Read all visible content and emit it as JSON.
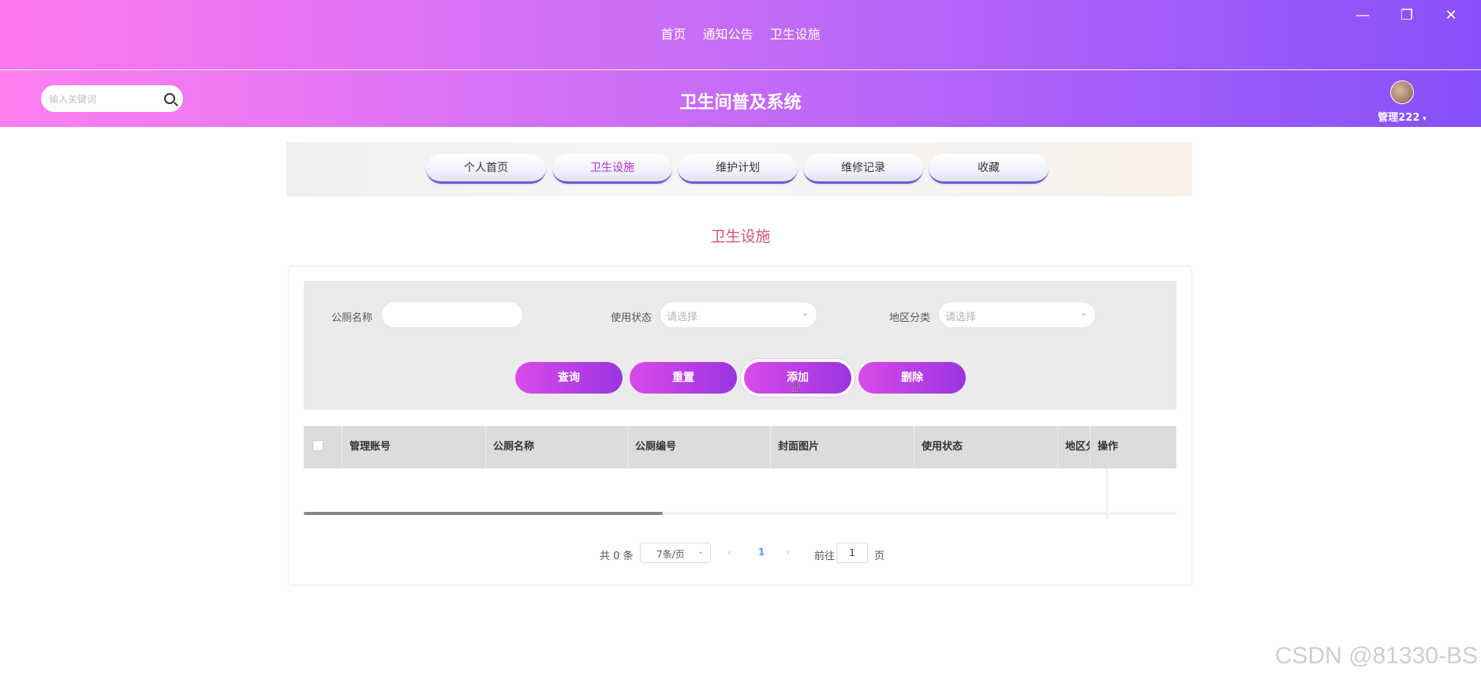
{
  "topnav": {
    "items": [
      "首页",
      "通知公告",
      "卫生设施"
    ]
  },
  "window_controls": {
    "minimize": "—",
    "restore": "❐",
    "close": "✕"
  },
  "header": {
    "search_placeholder": "输入关键词",
    "title": "卫生间普及系统",
    "user_name": "管理222",
    "caret": "▾"
  },
  "tabs": [
    {
      "label": "个人首页",
      "active": false
    },
    {
      "label": "卫生设施",
      "active": true
    },
    {
      "label": "维护计划",
      "active": false
    },
    {
      "label": "维修记录",
      "active": false
    },
    {
      "label": "收藏",
      "active": false
    }
  ],
  "section_title": "卫生设施",
  "filters": {
    "name_label": "公厕名称",
    "name_value": "",
    "status_label": "使用状态",
    "status_placeholder": "请选择",
    "region_label": "地区分类",
    "region_placeholder": "请选择"
  },
  "buttons": {
    "query": "查询",
    "reset": "重置",
    "add": "添加",
    "delete": "删除"
  },
  "table": {
    "columns": [
      "管理账号",
      "公厕名称",
      "公厕编号",
      "封面图片",
      "使用状态",
      "地区分",
      "操作"
    ],
    "rows": []
  },
  "pagination": {
    "total": "共 0 条",
    "page_size": "7条/页",
    "prev": "‹",
    "current_page": "1",
    "next": "›",
    "goto_label": "前往",
    "goto_value": "1",
    "page_unit": "页"
  },
  "watermark": "CSDN @81330-BS",
  "colors": {
    "accent": "#b13de6",
    "gradient_start": "#ff7ff0",
    "gradient_end": "#8650fb"
  }
}
